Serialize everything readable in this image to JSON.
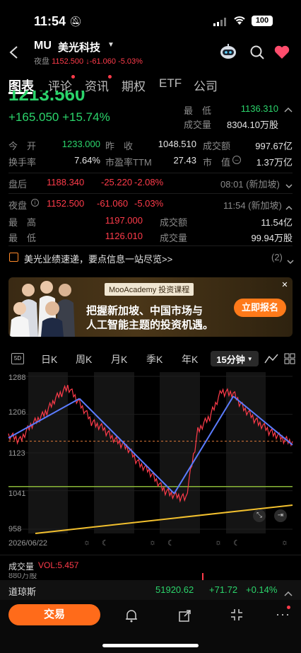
{
  "status_bar": {
    "time": "11:54",
    "battery": "100"
  },
  "header": {
    "symbol": "MU",
    "name": "美光科技",
    "night_label": "夜盘",
    "night_price": "1152.500",
    "night_change": "-61.060",
    "night_pct": "-5.03%"
  },
  "tabs": [
    {
      "label": "图表"
    },
    {
      "label": "评论"
    },
    {
      "label": "资讯"
    },
    {
      "label": "期权"
    },
    {
      "label": "ETF"
    },
    {
      "label": "公司"
    }
  ],
  "quote": {
    "price": "1213.560",
    "change": "+165.050",
    "change_pct": "+15.74%",
    "low_label": "最　低",
    "low": "1136.310",
    "volume_label": "成交量",
    "volume": "8304.10万股"
  },
  "stats": {
    "open_label": "今　开",
    "open": "1233.000",
    "prev_close_label": "昨　收",
    "prev_close": "1048.510",
    "turnover_label": "成交额",
    "turnover": "997.67亿",
    "turnover_rate_label": "换手率",
    "turnover_rate": "7.64%",
    "pe_label": "市盈率TTM",
    "pe": "27.43",
    "mcap_label": "市　值",
    "mcap": "1.37万亿"
  },
  "after_hours": {
    "label": "盘后",
    "price": "1188.340",
    "change": "-25.220",
    "pct": "-2.08%",
    "time": "08:01 (新加坡)"
  },
  "night": {
    "label": "夜盘",
    "price": "1152.500",
    "change": "-61.060",
    "pct": "-5.03%",
    "time": "11:54 (新加坡)",
    "high_label": "最　高",
    "high": "1197.000",
    "amount_label": "成交额",
    "amount": "11.54亿",
    "low_label": "最　低",
    "low": "1126.010",
    "volume_label": "成交量",
    "volume": "99.94万股"
  },
  "news": {
    "text": "美光业绩速递，要点信息一站尽览>>",
    "count": "(2)"
  },
  "ad": {
    "badge": "MooAcademy 投资课程",
    "line1": "把握新加坡、中国市场与",
    "line2": "人工智能主题的投资机遇。",
    "cta": "立即报名"
  },
  "periods": [
    {
      "label": "日K"
    },
    {
      "label": "周K"
    },
    {
      "label": "月K"
    },
    {
      "label": "季K"
    },
    {
      "label": "年K"
    },
    {
      "label": "15分钟"
    }
  ],
  "period_icon": "5D",
  "chart_data": {
    "type": "line",
    "title": "",
    "y_ticks": [
      "1288",
      "1206",
      "1123",
      "1041",
      "958"
    ],
    "ylim": [
      958,
      1288
    ],
    "x_label": "2026/06/22",
    "series": [
      {
        "values": [
          1160,
          1150,
          1185,
          1205,
          1240,
          1265,
          1230,
          1190,
          1175,
          1150,
          1135,
          1100,
          1080,
          1045,
          1030,
          1025,
          1170,
          1200,
          1255,
          1250,
          1215,
          1190,
          1170,
          1155,
          1145
        ]
      }
    ],
    "trend_lines": [
      {
        "from": [
          0,
          1155
        ],
        "to": [
          6,
          1240
        ]
      },
      {
        "from": [
          6,
          1240
        ],
        "to": [
          14,
          1035
        ]
      },
      {
        "from": [
          14,
          1035
        ],
        "to": [
          19,
          1245
        ]
      },
      {
        "from": [
          19,
          1245
        ],
        "to": [
          24,
          1140
        ]
      }
    ],
    "support_line": 1050,
    "reference_line": 1148,
    "color_line": "#ff3b4a"
  },
  "volume": {
    "label": "成交量",
    "vol": "VOL:5.457",
    "axis": "880万股"
  },
  "index_bar": {
    "name": "道琼斯",
    "value": "51920.62",
    "change": "+71.72",
    "pct": "+0.14%"
  },
  "bottom": {
    "trade": "交易"
  }
}
